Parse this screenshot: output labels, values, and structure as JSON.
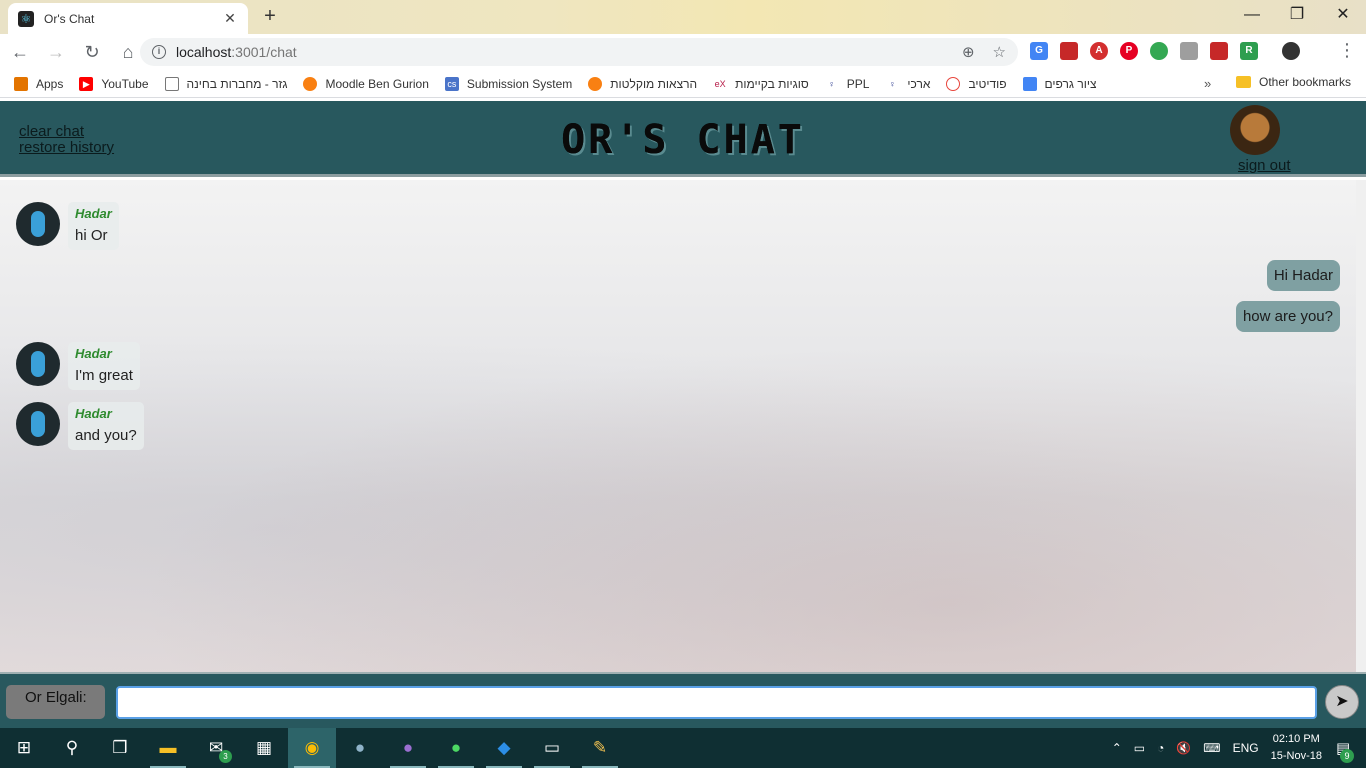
{
  "browser": {
    "tab_title": "Or's Chat",
    "url_host": "localhost",
    "url_path": ":3001/chat",
    "bookmarks": [
      {
        "label": "Apps",
        "icon": "apps-grid-icon",
        "color": "#e37400"
      },
      {
        "label": "YouTube",
        "icon": "youtube-icon",
        "color": "#ff0000"
      },
      {
        "label": "גזר - מחברות בחינה",
        "icon": "page-icon",
        "color": "#9e9e9e"
      },
      {
        "label": "Moodle Ben Gurion",
        "icon": "moodle-icon",
        "color": "#f98012"
      },
      {
        "label": "Submission System",
        "icon": "cs-icon",
        "color": "#4a74c9"
      },
      {
        "label": "הרצאות מוקלטות",
        "icon": "lectures-icon",
        "color": "#f98012"
      },
      {
        "label": "סוגיות בקיימות",
        "icon": "edx-icon",
        "color": "#b8204b"
      },
      {
        "label": "PPL",
        "icon": "ppl-icon",
        "color": "#2b3a8f"
      },
      {
        "label": "ארכי",
        "icon": "archi-icon",
        "color": "#2b3a8f"
      },
      {
        "label": "פודיטיב",
        "icon": "clock-icon",
        "color": "#e8453c"
      },
      {
        "label": "ציור גרפים",
        "icon": "grid-icon",
        "color": "#4285f4"
      }
    ],
    "more_bookmarks": "»",
    "other_bookmarks": "Other bookmarks"
  },
  "header": {
    "clear_chat": "clear chat",
    "restore_history": "restore history",
    "title": "OR'S CHAT",
    "sign_out": "sign out"
  },
  "messages": {
    "m1": {
      "sender": "Hadar",
      "text": "hi Or"
    },
    "m2": {
      "text": "Hi Hadar"
    },
    "m3": {
      "text": "how are you?"
    },
    "m4": {
      "sender": "Hadar",
      "text": "I'm great"
    },
    "m5": {
      "sender": "Hadar",
      "text": "and you?"
    }
  },
  "input": {
    "user_label": "Or Elgali:",
    "value": "",
    "send_icon": "send-arrow-icon"
  },
  "taskbar": {
    "mail_badge": "3",
    "language": "ENG",
    "time": "02:10 PM",
    "date": "15-Nov-18",
    "notifications_badge": "9"
  },
  "colors": {
    "header_bg": "#28585e",
    "sender_name": "#2e8b2e",
    "outgoing_bubble": "#7fa0a2"
  }
}
